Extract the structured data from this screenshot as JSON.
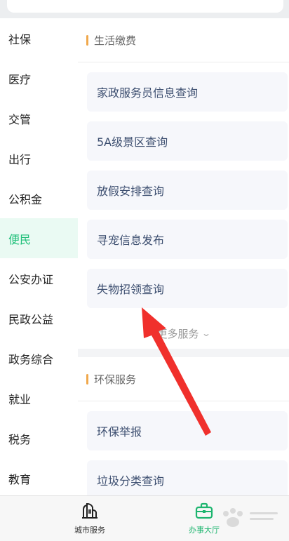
{
  "sidebar": {
    "items": [
      {
        "label": "社保"
      },
      {
        "label": "医疗"
      },
      {
        "label": "交管"
      },
      {
        "label": "出行"
      },
      {
        "label": "公积金"
      },
      {
        "label": "便民"
      },
      {
        "label": "公安办证"
      },
      {
        "label": "民政公益"
      },
      {
        "label": "政务综合"
      },
      {
        "label": "就业"
      },
      {
        "label": "税务"
      },
      {
        "label": "教育"
      }
    ],
    "active_label": "便民"
  },
  "sections": [
    {
      "title": "生活缴费",
      "items": [
        "家政服务员信息查询",
        "5A级景区查询",
        "放假安排查询",
        "寻宠信息发布",
        "失物招领查询"
      ],
      "more_label": "更多服务"
    },
    {
      "title": "环保服务",
      "items": [
        "环保举报",
        "垃圾分类查询"
      ]
    }
  ],
  "tabbar": {
    "tabs": [
      {
        "label": "城市服务",
        "icon": "city-building-icon"
      },
      {
        "label": "办事大厅",
        "icon": "briefcase-icon"
      }
    ],
    "active_label": "办事大厅"
  },
  "colors": {
    "accent_green": "#20c07a",
    "section_marker": "#f0a84c",
    "annotation_arrow": "#f0302c"
  }
}
